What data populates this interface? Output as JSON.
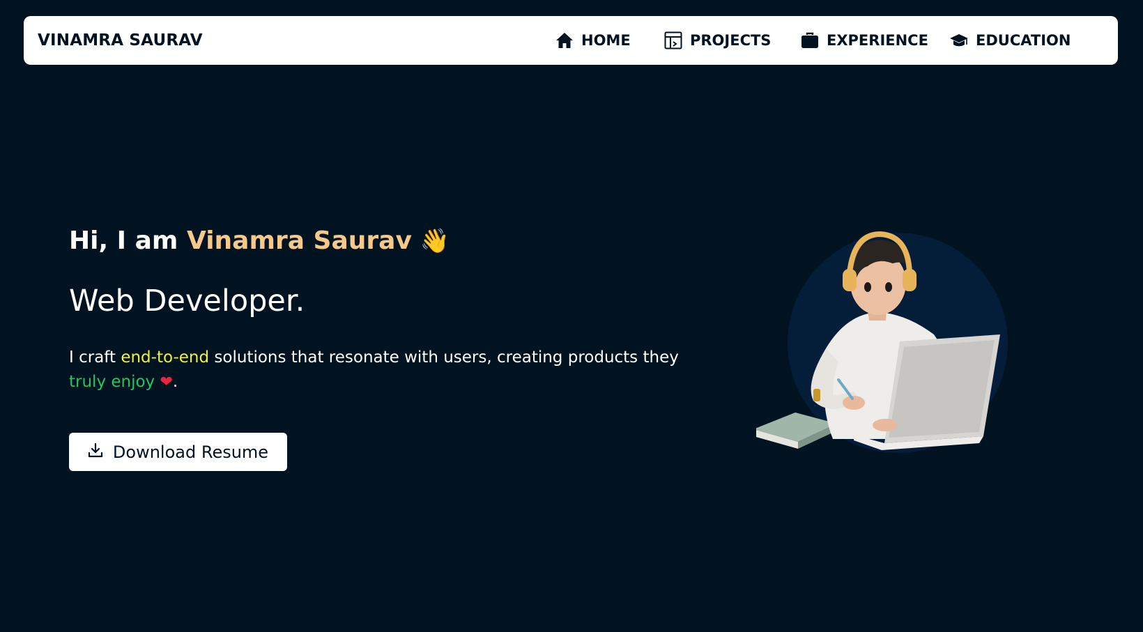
{
  "navbar": {
    "brand": "VINAMRA SAURAV",
    "items": [
      {
        "label": "HOME",
        "icon": "home-icon"
      },
      {
        "label": "PROJECTS",
        "icon": "projects-icon"
      },
      {
        "label": "EXPERIENCE",
        "icon": "briefcase-icon"
      },
      {
        "label": "EDUCATION",
        "icon": "graduation-cap-icon"
      }
    ]
  },
  "hero": {
    "greeting_prefix": "Hi, I am",
    "name": "Vinamra Saurav",
    "wave": "👋",
    "role": "Web Developer.",
    "tagline": {
      "part1": "I craft ",
      "highlight1": "end-to-end",
      "part2": " solutions that resonate with users, creating products they ",
      "highlight2": "truly enjoy",
      "heart": "❤",
      "end": "."
    },
    "download_label": "Download Resume"
  },
  "colors": {
    "background": "#011221",
    "name_accent": "#f6c98a",
    "highlight_yellow": "#f2f22e",
    "highlight_green": "#22c55e",
    "heart": "#ef233c"
  }
}
